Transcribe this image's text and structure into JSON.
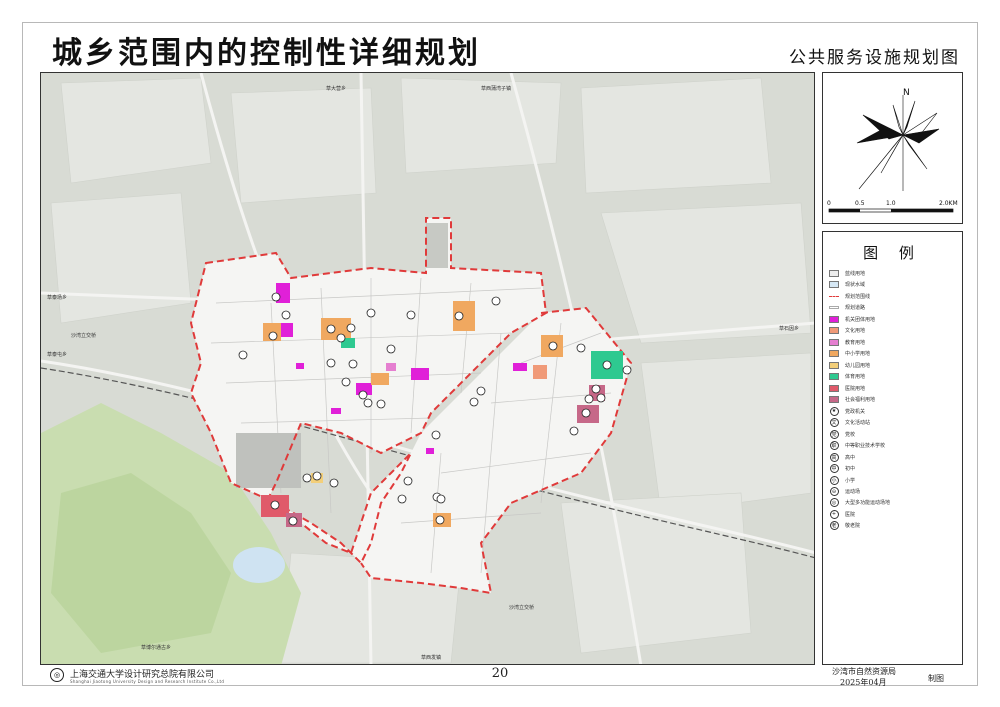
{
  "header": {
    "title": "城乡范围内的控制性详细规划",
    "subtitle": "公共服务设施规划图"
  },
  "map": {
    "place_labels": [
      {
        "id": "village-n1",
        "text": "草大营乡"
      },
      {
        "id": "village-n2",
        "text": "草西蒲湾子镇"
      },
      {
        "id": "village-w1",
        "text": "草泰场乡"
      },
      {
        "id": "village-w2",
        "text": "沙湾立交桥"
      },
      {
        "id": "village-w3",
        "text": "草泰屯乡"
      },
      {
        "id": "village-e1",
        "text": "草石因乡"
      },
      {
        "id": "village-s1",
        "text": "沙湾立交桥"
      },
      {
        "id": "village-s2",
        "text": "草博尔通古乡"
      },
      {
        "id": "village-s3",
        "text": "草西发镇"
      }
    ],
    "facility_colors": {
      "admin": "#e020d8",
      "culture": "#f09a78",
      "education": "#f0a860",
      "sports": "#2ec990",
      "medical": "#e05a6a",
      "welfare": "#c66888",
      "boundary": "#e03a3a"
    }
  },
  "compass": {
    "north_label": "N",
    "scale_ticks": [
      "0",
      "0.5",
      "1.0",
      "2.0KM"
    ]
  },
  "legend": {
    "title": "图  例",
    "items": [
      {
        "label": "蓝线用地",
        "type": "fill",
        "color": "#ececec"
      },
      {
        "label": "现状水域",
        "type": "fill",
        "color": "#d6e8f5"
      },
      {
        "label": "规划范围线",
        "type": "dash",
        "color": "#e03a3a"
      },
      {
        "label": "规划道路",
        "type": "line",
        "color": "#ffffff"
      },
      {
        "label": "机关团体用地",
        "type": "fill",
        "color": "#e020d8"
      },
      {
        "label": "文化用地",
        "type": "fill",
        "color": "#f09a78"
      },
      {
        "label": "教育用地",
        "type": "fill",
        "color": "#e57fd0"
      },
      {
        "label": "中小学用地",
        "type": "fill",
        "color": "#f0a860"
      },
      {
        "label": "幼儿园用地",
        "type": "fill",
        "color": "#f3cf7a"
      },
      {
        "label": "体育用地",
        "type": "fill",
        "color": "#2ec990"
      },
      {
        "label": "医院用地",
        "type": "fill",
        "color": "#e05a6a"
      },
      {
        "label": "社会福利用地",
        "type": "fill",
        "color": "#c66888"
      },
      {
        "label": "党政机关",
        "type": "symbol",
        "glyph": "★"
      },
      {
        "label": "文化活动站",
        "type": "symbol",
        "glyph": "文"
      },
      {
        "label": "党校",
        "type": "symbol",
        "glyph": "党"
      },
      {
        "label": "中等职业技术学校",
        "type": "symbol",
        "glyph": "职"
      },
      {
        "label": "高中",
        "type": "symbol",
        "glyph": "高"
      },
      {
        "label": "初中",
        "type": "symbol",
        "glyph": "中"
      },
      {
        "label": "小学",
        "type": "symbol",
        "glyph": "小"
      },
      {
        "label": "运动场",
        "type": "symbol",
        "glyph": "⊖"
      },
      {
        "label": "大型多功能运动场地",
        "type": "symbol",
        "glyph": "◎"
      },
      {
        "label": "医院",
        "type": "symbol",
        "glyph": "+"
      },
      {
        "label": "敬老院",
        "type": "symbol",
        "glyph": "老"
      }
    ]
  },
  "footer": {
    "org_name": "上海交通大学设计研究总院有限公司",
    "org_name_en": "Shanghai Jiaotong University Design and Research Institute Co.,Ltd",
    "page_number": "20",
    "agency": "沙湾市自然资源局",
    "date": "2025年04月",
    "made_label": "制图"
  }
}
